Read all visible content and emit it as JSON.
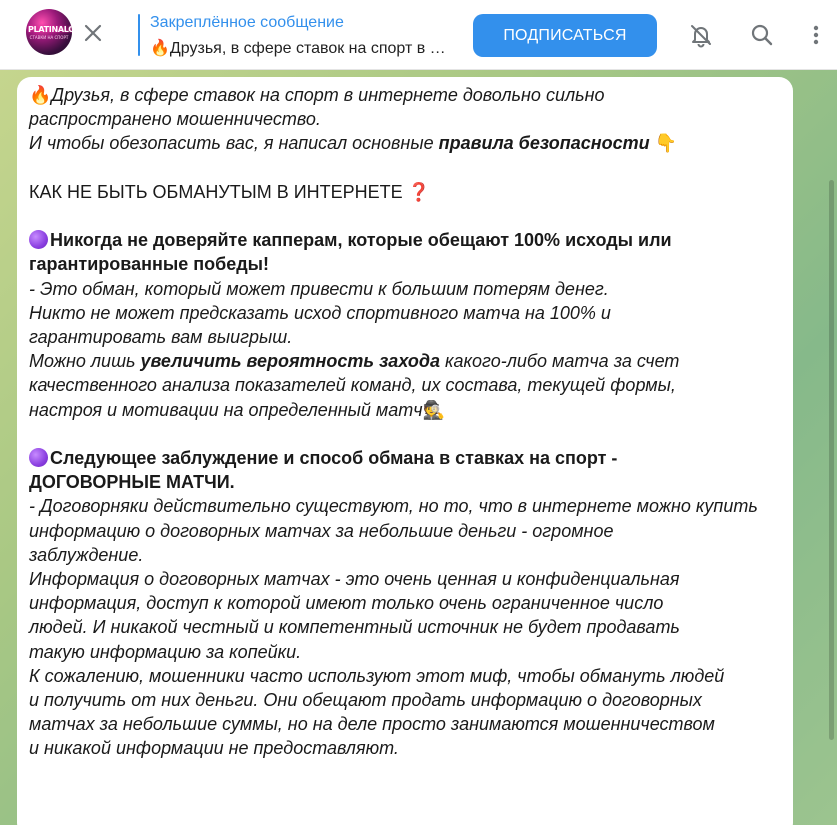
{
  "header": {
    "channel_avatar_text": "PLATINALOX",
    "channel_avatar_subtext": "СТАВКИ НА СПОРТ",
    "pinned_title": "Закреплённое сообщение",
    "pinned_text": "🔥Друзья, в сфере ставок на спорт в интернете довольно сильно распространено мошенничество.",
    "subscribe_label": "ПОДПИСАТЬСЯ",
    "icons": [
      "close-icon",
      "bell-muted-icon",
      "search-icon",
      "more-vertical-icon"
    ]
  },
  "message": {
    "intro_line1": "Друзья, в сфере ставок на спорт в интернете довольно сильно",
    "intro_line2": "распространено мошенничество.",
    "intro_line3_a": "И чтобы обезопасить вас, я написал основные ",
    "intro_line3_b": "правила безопасности",
    "heading": "КАК НЕ БЫТЬ ОБМАНУТЫМ В ИНТЕРНЕТЕ ",
    "s1_title_line1": "Никогда не доверяйте капперам, которые обещают 100% исходы или",
    "s1_title_line2": "гарантированные победы!",
    "s1_line1": "- Это обман, который может привести к большим потерям денег.",
    "s1_line2": "Никто не может предсказать исход спортивного матча на 100% и",
    "s1_line3": "гарантировать вам выигрыш.",
    "s1_line4_a": "Можно лишь ",
    "s1_line4_b": "увеличить вероятность захода",
    "s1_line4_c": " какого-либо матча за счет",
    "s1_line5": "качественного анализа показателей команд, их состава, текущей формы,",
    "s1_line6": "настроя и мотивации на определенный матч",
    "s2_title_line1": "Следующее заблуждение и способ обмана в ставках на спорт -",
    "s2_title_line2": "ДОГОВОРНЫЕ МАТЧИ.",
    "s2_line1": "- Договорняки действительно существуют, но то, что в интернете можно купить",
    "s2_line2": "информацию о договорных матчах за небольшие деньги - огромное",
    "s2_line3": "заблуждение.",
    "s2_line4": "Информация о договорных матчах - это очень ценная и конфиденциальная",
    "s2_line5": "информация, доступ к которой имеют только очень ограниченное число",
    "s2_line6": "людей. И никакой честный и компетентный источник не будет продавать",
    "s2_line7": "такую информацию за копейки.",
    "s2_line8": "К сожалению, мошенники часто используют этот миф, чтобы обмануть людей",
    "s2_line9": "и получить от них деньги. Они обещают продать информацию о договорных",
    "s2_line10": "матчах за небольшие суммы, но на деле просто занимаются мошенничеством",
    "s2_line11": "и никакой информации не предоставляют."
  },
  "colors": {
    "accent": "#3390ec",
    "header_bg": "#ffffff",
    "bubble_bg": "#ffffff"
  }
}
